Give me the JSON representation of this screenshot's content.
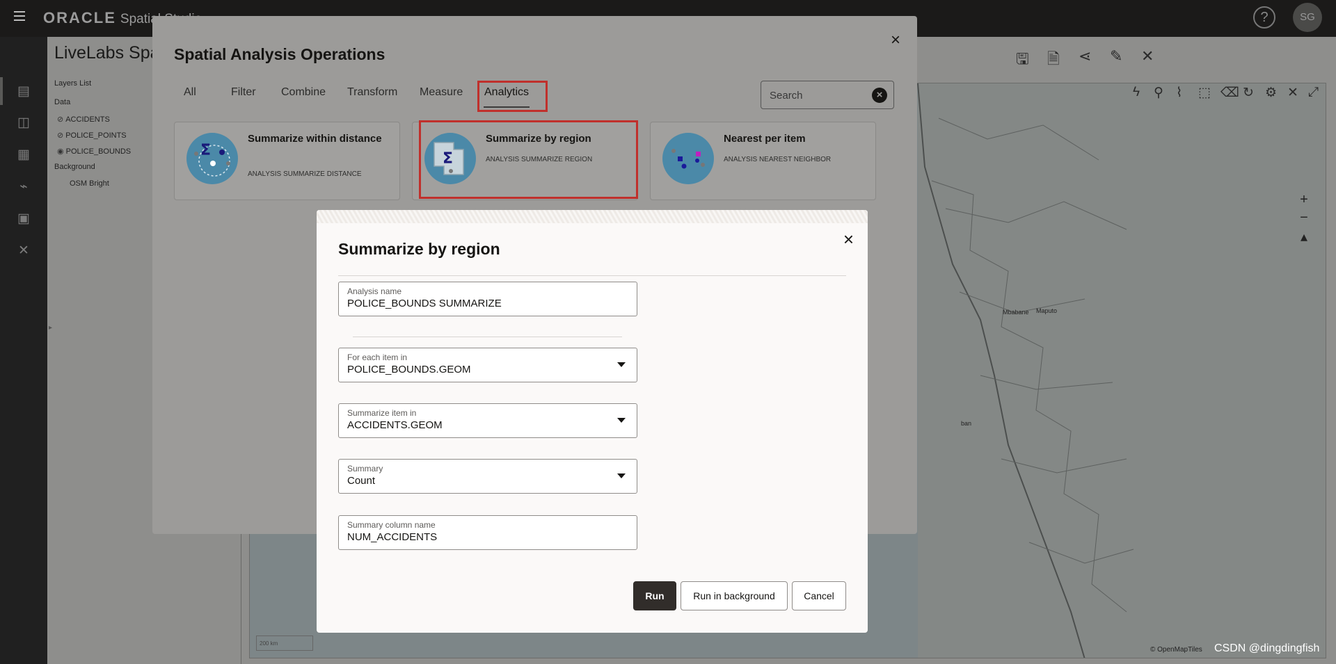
{
  "topbar": {
    "brand": "ORACLE",
    "product": "Spatial Studio",
    "help_icon": "question-circle-icon",
    "avatar_initials": "SG"
  },
  "project": {
    "title": "LiveLabs Spat",
    "layers_heading": "Layers List",
    "data_heading": "Data",
    "layers": [
      {
        "name": "ACCIDENTS",
        "icon": "eye-hidden-icon"
      },
      {
        "name": "POLICE_POINTS",
        "icon": "eye-hidden-icon"
      },
      {
        "name": "POLICE_BOUNDS",
        "icon": "eye-icon"
      }
    ],
    "background_heading": "Background",
    "background_layer": "OSM Bright"
  },
  "map": {
    "labels": [
      "Maputo",
      "Mbabane",
      "ban"
    ],
    "attribution": "© OpenMapTiles",
    "scale": "200 km"
  },
  "watermark": "CSDN @dingdingfish",
  "ops_dialog": {
    "title": "Spatial Analysis Operations",
    "tabs": [
      "All",
      "Filter",
      "Combine",
      "Transform",
      "Measure",
      "Analytics"
    ],
    "active_tab": "Analytics",
    "search_placeholder": "Search",
    "cards": [
      {
        "title": "Summarize within distance",
        "subtitle": "ANALYSIS SUMMARIZE DISTANCE"
      },
      {
        "title": "Summarize by region",
        "subtitle": "ANALYSIS SUMMARIZE REGION"
      },
      {
        "title": "Nearest per item",
        "subtitle": "ANALYSIS NEAREST NEIGHBOR"
      }
    ]
  },
  "region_dialog": {
    "title": "Summarize by region",
    "fields": {
      "analysis_name": {
        "label": "Analysis name",
        "value": "POLICE_BOUNDS SUMMARIZE"
      },
      "for_each": {
        "label": "For each item in",
        "value": "POLICE_BOUNDS.GEOM"
      },
      "summarize_item": {
        "label": "Summarize item in",
        "value": "ACCIDENTS.GEOM"
      },
      "summary": {
        "label": "Summary",
        "value": "Count"
      },
      "summary_column": {
        "label": "Summary column name",
        "value": "NUM_ACCIDENTS"
      }
    },
    "buttons": {
      "run": "Run",
      "run_background": "Run in background",
      "cancel": "Cancel"
    }
  }
}
